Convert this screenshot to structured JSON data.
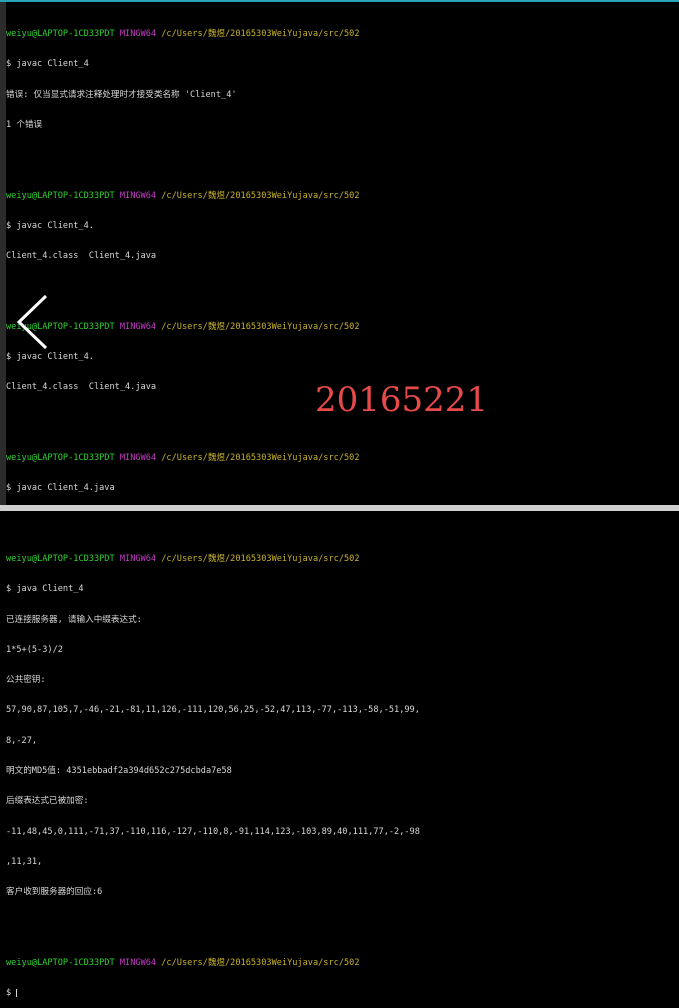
{
  "prompt": {
    "user": "weiyu@LAPTOP-1CD33PDT",
    "shell": "MINGW64",
    "path1": "/c/Users/魏煜/20165303WeiYujava/src/502",
    "path2": "/c/Users/魏煜/20165303WeiYujava/src/502",
    "path3": "/c/Users/魏煜/20165303WeiYujava/src/502",
    "path4": "/c/Users/魏煜/20165303WeiYujava/src/502",
    "path5": "/c/Users/魏煜/20165303WeiYujava/src/502",
    "path6": "/c/Users/魏煜/20165303WeiYujava/src/502"
  },
  "session": {
    "cmd1": "$ javac Client_4",
    "err1": "错误: 仅当显式请求注释处理时才接受类名称 'Client_4'",
    "err2": "1 个错误",
    "cmd2": "$ javac Client_4.",
    "ls1": "Client_4.class  Client_4.java",
    "cmd3": "$ javac Client_4.",
    "ls2": "Client_4.class  Client_4.java",
    "cmd4": "$ javac Client_4.java",
    "cmd5": "$ java Client_4",
    "out1": "已连接服务器, 请输入中缀表达式:",
    "out2": "1*5+(5-3)/2",
    "out3": "公共密钥:",
    "out4": "57,90,87,105,7,-46,-21,-81,11,126,-111,120,56,25,-52,47,113,-77,-113,-58,-51,99,",
    "out5": "8,-27,",
    "out6": "明文的MD5值: 4351ebbadf2a394d652c275dcbda7e58",
    "out7": "后缀表达式已被加密:",
    "out8": "-11,48,45,0,111,-71,37,-110,116,-127,-110,8,-91,114,123,-103,89,40,111,77,-2,-98",
    "out9": ",11,31,",
    "out10": "客户收到服务器的回应:6",
    "cmd6": "$ "
  },
  "overlay": {
    "watermark": "20165221",
    "back_icon": "chevron-left-icon",
    "watermark_color": "#e84a4a"
  }
}
